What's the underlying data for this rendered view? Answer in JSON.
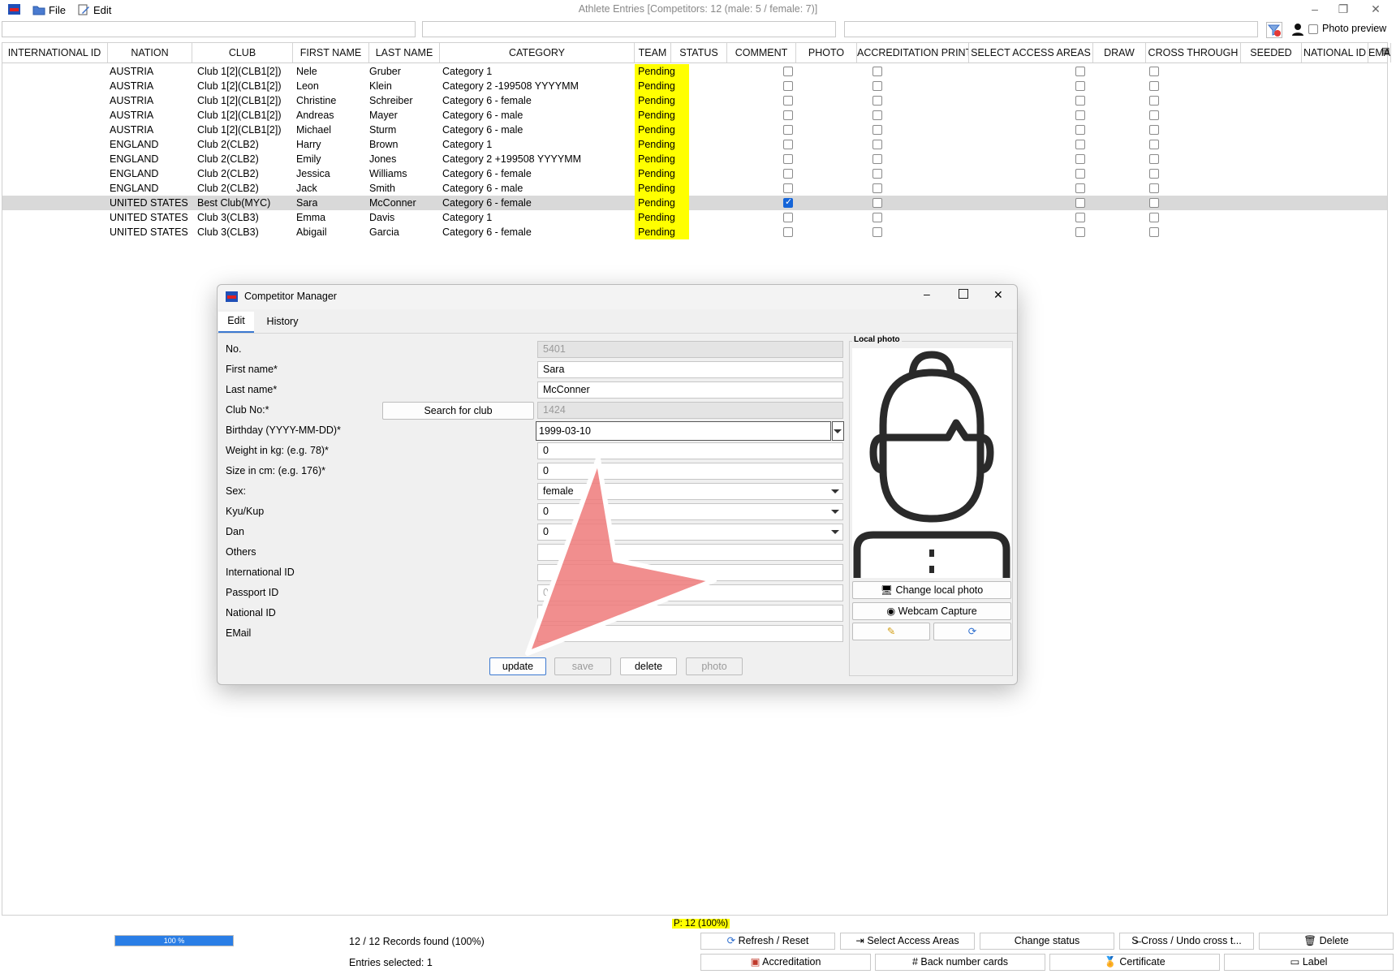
{
  "window": {
    "title": "Athlete Entries [Competitors: 12 (male: 5 / female: 7)]"
  },
  "menu": {
    "file": "File",
    "edit": "Edit"
  },
  "toolbar": {
    "photo_preview": "Photo preview"
  },
  "table": {
    "columns": [
      "INTERNATIONAL ID",
      "NATION",
      "CLUB",
      "FIRST NAME",
      "LAST NAME",
      "CATEGORY",
      "TEAM",
      "STATUS",
      "COMMENT",
      "PHOTO",
      "ACCREDITATION PRINT",
      "SELECT ACCESS AREAS",
      "DRAW",
      "CROSS THROUGH",
      "SEEDED",
      "NATIONAL ID",
      "EMAIL"
    ],
    "rows": [
      {
        "nation": "AUSTRIA",
        "club": "Club 1[2](CLB1[2])",
        "first": "Nele",
        "last": "Gruber",
        "category": "Category 1",
        "status": "Pending",
        "photo": false
      },
      {
        "nation": "AUSTRIA",
        "club": "Club 1[2](CLB1[2])",
        "first": "Leon",
        "last": "Klein",
        "category": "Category 2 -199508 YYYYMM",
        "status": "Pending",
        "photo": false
      },
      {
        "nation": "AUSTRIA",
        "club": "Club 1[2](CLB1[2])",
        "first": "Christine",
        "last": "Schreiber",
        "category": "Category 6 - female",
        "status": "Pending",
        "photo": false
      },
      {
        "nation": "AUSTRIA",
        "club": "Club 1[2](CLB1[2])",
        "first": "Andreas",
        "last": "Mayer",
        "category": "Category 6 - male",
        "status": "Pending",
        "photo": false
      },
      {
        "nation": "AUSTRIA",
        "club": "Club 1[2](CLB1[2])",
        "first": "Michael",
        "last": "Sturm",
        "category": "Category 6 - male",
        "status": "Pending",
        "photo": false
      },
      {
        "nation": "ENGLAND",
        "club": "Club 2(CLB2)",
        "first": "Harry",
        "last": "Brown",
        "category": "Category 1",
        "status": "Pending",
        "photo": false
      },
      {
        "nation": "ENGLAND",
        "club": "Club 2(CLB2)",
        "first": "Emily",
        "last": "Jones",
        "category": "Category 2 +199508 YYYYMM",
        "status": "Pending",
        "photo": false
      },
      {
        "nation": "ENGLAND",
        "club": "Club 2(CLB2)",
        "first": "Jessica",
        "last": "Williams",
        "category": "Category 6 - female",
        "status": "Pending",
        "photo": false
      },
      {
        "nation": "ENGLAND",
        "club": "Club 2(CLB2)",
        "first": "Jack",
        "last": "Smith",
        "category": "Category 6 - male",
        "status": "Pending",
        "photo": false
      },
      {
        "nation": "UNITED STATES",
        "club": "Best Club(MYC)",
        "first": "Sara",
        "last": "McConner",
        "category": "Category 6 - female",
        "status": "Pending",
        "photo": true
      },
      {
        "nation": "UNITED STATES",
        "club": "Club 3(CLB3)",
        "first": "Emma",
        "last": "Davis",
        "category": "Category 1",
        "status": "Pending",
        "photo": false
      },
      {
        "nation": "UNITED STATES",
        "club": "Club 3(CLB3)",
        "first": "Abigail",
        "last": "Garcia",
        "category": "Category 6 - female",
        "status": "Pending",
        "photo": false
      }
    ],
    "selected_row_index": 9
  },
  "dialog": {
    "title": "Competitor Manager",
    "tabs": [
      "Edit",
      "History"
    ],
    "active_tab": "Edit",
    "labels": {
      "no": "No.",
      "first_name": "First name*",
      "last_name": "Last name*",
      "club_no": "Club No:*",
      "birthday": "Birthday (YYYY-MM-DD)*",
      "weight": "Weight in kg: (e.g. 78)*",
      "size": "Size in cm: (e.g. 176)*",
      "sex": "Sex:",
      "kyu": "Kyu/Kup",
      "dan": "Dan",
      "others": "Others",
      "international_id": "International ID",
      "passport_id": "Passport ID",
      "national_id": "National ID",
      "email": "EMail"
    },
    "values": {
      "no": "5401",
      "first_name": "Sara",
      "last_name": "McConner",
      "club_no": "1424",
      "birthday": "1999-03-10",
      "weight": "0",
      "size": "0",
      "sex": "female",
      "kyu": "0",
      "dan": "0",
      "others": "",
      "international_id": "",
      "passport_id": "0",
      "national_id": "",
      "email": ""
    },
    "search_club_button": "Search for club",
    "photo_group_label": "Local photo",
    "change_photo_button": "Change local photo",
    "webcam_button": "Webcam Capture",
    "buttons": {
      "update": "update",
      "save": "save",
      "delete": "delete",
      "photo": "photo"
    }
  },
  "statusbar": {
    "progress_label": "100 %",
    "progress_fraction": 1.0,
    "records_found": "12 / 12 Records found (100%)",
    "entries_selected": "Entries selected: 1",
    "p_badge": "P: 12 (100%)"
  },
  "actions": {
    "refresh": "Refresh / Reset",
    "select_access": "Select Access Areas",
    "change_status": "Change status",
    "cross": "Cross / Undo cross t...",
    "delete": "Delete",
    "accreditation": "Accreditation",
    "back_number": "Back number cards",
    "certificate": "Certificate",
    "label": "Label"
  },
  "colors": {
    "status_pending": "#ffff00",
    "accent": "#1565d8",
    "overlay_arrow": "#ef7e7e"
  }
}
